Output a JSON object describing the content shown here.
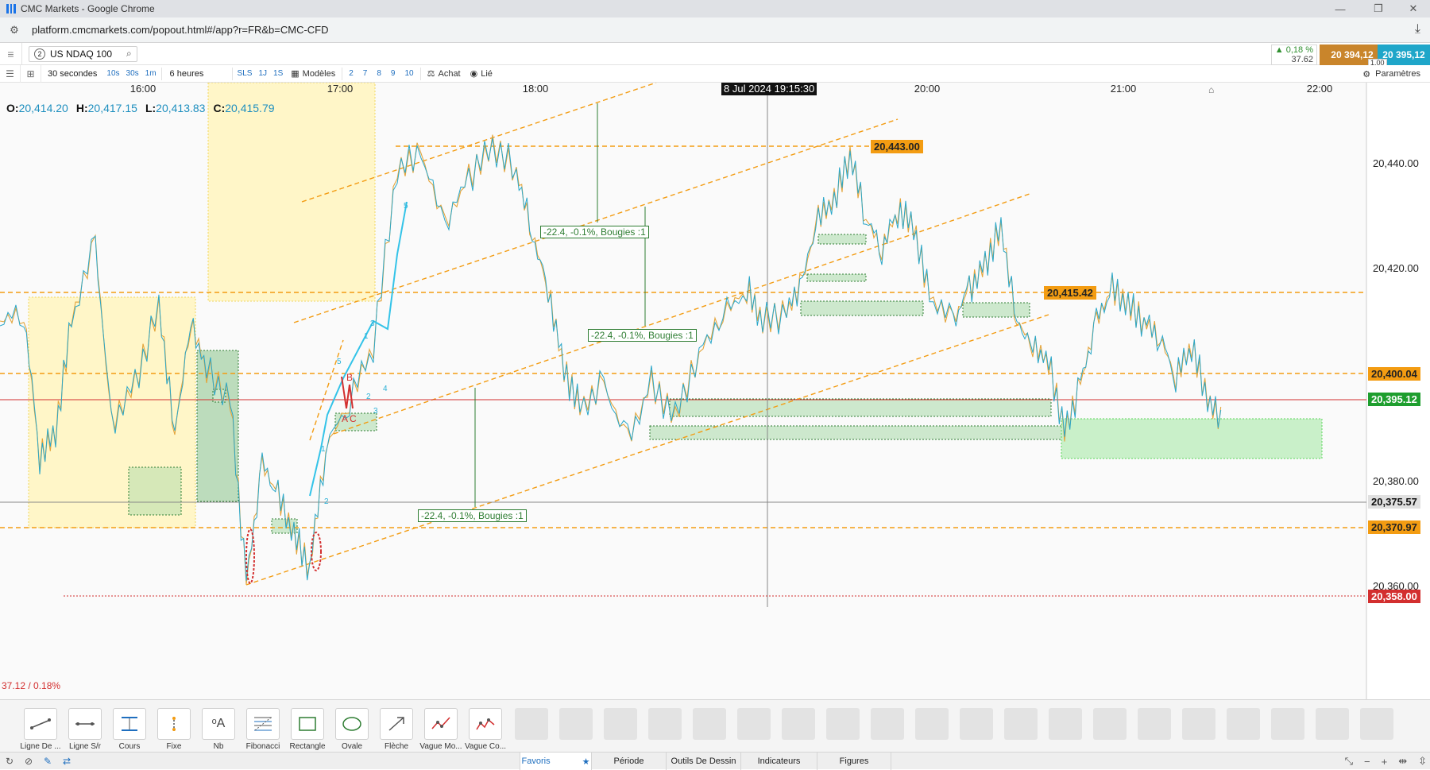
{
  "window": {
    "title": "CMC Markets - Google Chrome"
  },
  "browser": {
    "url": "platform.cmcmarkets.com/popout.html#/app?r=FR&b=CMC-CFD"
  },
  "instrument": {
    "index": "2",
    "name": "US NDAQ 100"
  },
  "quote": {
    "change_pct": "0,18 %",
    "change_abs": "37.62",
    "bid": "20 394,12",
    "ask": "20 395,12",
    "spread": "1.00"
  },
  "toolbar": {
    "interval": "30 secondes",
    "intervals": [
      "10s",
      "30s",
      "1m"
    ],
    "range": "6 heures",
    "quick_ranges": [
      "SLS",
      "1J",
      "1S"
    ],
    "templates": "Modèles",
    "counts": [
      "2",
      "7",
      "8",
      "9",
      "10"
    ],
    "buy": "Achat",
    "linked": "Lié",
    "settings": "Paramètres"
  },
  "ohlc": {
    "o_label": "O:",
    "o": "20,414.20",
    "h_label": "H:",
    "h": "20,417.15",
    "l_label": "L:",
    "l": "20,413.83",
    "c_label": "C:",
    "c": "20,415.79"
  },
  "time_axis": [
    "16:00",
    "17:00",
    "18:00",
    "20:00",
    "21:00",
    "22:00"
  ],
  "crosshair_date": "8 Jul 2024 19:15:30",
  "price_axis": [
    "20,440.00",
    "20,420.00",
    "20,380.00",
    "20,360.00"
  ],
  "price_tags": {
    "high_level": "20,443.00",
    "mid_level": "20,415.42",
    "level_400": "20,400.04",
    "current": "20,395.12",
    "crosshair": "20,375.57",
    "level_370": "20,370.97",
    "low": "20,358.00"
  },
  "measures": [
    "-22.4, -0.1%, Bougies :1",
    "-22.4, -0.1%, Bougies :1",
    "-22.4, -0.1%, Bougies :1"
  ],
  "change_tag": "37.12 / 0.18%",
  "wave_labels": [
    "5",
    "3",
    "1",
    "2",
    "1",
    "2",
    "3",
    "4",
    "5",
    "B",
    "A",
    "C"
  ],
  "colors": {
    "bid": "#c9852b",
    "ask": "#1fa6c9",
    "up": "#2f8f2f",
    "down": "#d32f2f",
    "fib": "#f39c12"
  },
  "draw_tools": [
    {
      "label": "Ligne De ...",
      "icon": "trend-line-icon"
    },
    {
      "label": "Ligne S/r",
      "icon": "sr-line-icon"
    },
    {
      "label": "Cours",
      "icon": "price-range-icon"
    },
    {
      "label": "Fixe",
      "icon": "fixed-line-icon"
    },
    {
      "label": "Nb",
      "icon": "text-icon"
    },
    {
      "label": "Fibonacci",
      "icon": "fibonacci-icon"
    },
    {
      "label": "Rectangle",
      "icon": "rectangle-icon"
    },
    {
      "label": "Ovale",
      "icon": "oval-icon"
    },
    {
      "label": "Flèche",
      "icon": "arrow-icon"
    },
    {
      "label": "Vague Mo...",
      "icon": "wave-icon"
    },
    {
      "label": "Vague Co...",
      "icon": "wave-co-icon"
    }
  ],
  "status_tabs": [
    "Favoris",
    "Période",
    "Outils De Dessin",
    "Indicateurs",
    "Figures"
  ]
}
